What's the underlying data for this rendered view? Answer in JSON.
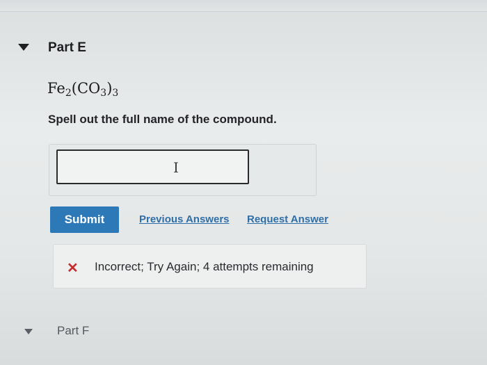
{
  "part_e": {
    "title": "Part E",
    "formula": {
      "element1": "Fe",
      "sub1": "2",
      "open": "(CO",
      "sub2": "3",
      "close": ")",
      "sub3": "3"
    },
    "prompt": "Spell out the full name of the compound.",
    "answer": {
      "value": "",
      "placeholder": ""
    },
    "submit_label": "Submit",
    "previous_answers_label": "Previous Answers",
    "request_answer_label": "Request Answer",
    "feedback": {
      "icon": "x-icon",
      "text": "Incorrect; Try Again; 4 attempts remaining",
      "color": "#c62e2e"
    }
  },
  "part_f": {
    "title": "Part F"
  },
  "colors": {
    "accent": "#2d79b8",
    "link": "#2f6fa8",
    "error": "#c62e2e"
  }
}
